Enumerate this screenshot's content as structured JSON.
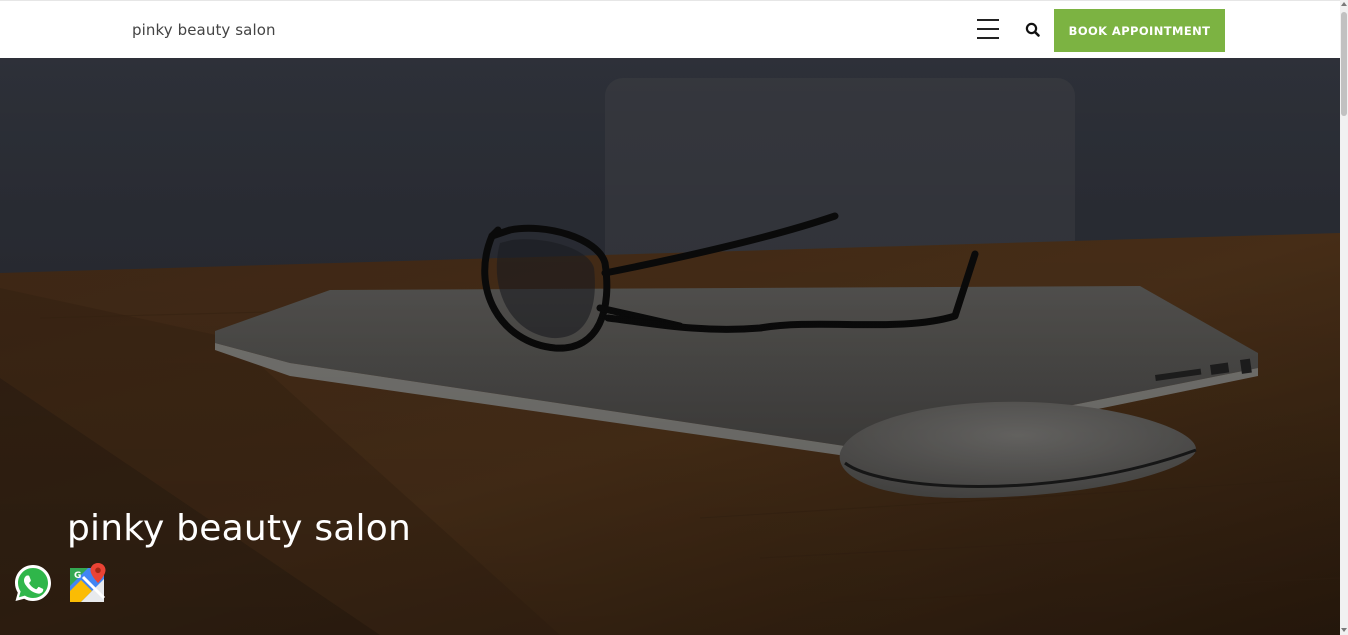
{
  "header": {
    "brand": "pinky beauty salon",
    "menu_icon": "hamburger-menu-icon",
    "search_icon": "search-icon",
    "book_button_label": "BOOK APPOINTMENT",
    "book_button_color": "#7cb342"
  },
  "hero": {
    "title": "pinky beauty salon",
    "background": "glasses-on-laptop-with-mouse-on-wooden-desk"
  },
  "floating": {
    "whatsapp_icon": "whatsapp-icon",
    "maps_icon": "google-maps-icon"
  }
}
